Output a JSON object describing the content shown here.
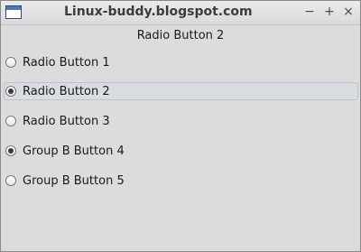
{
  "window": {
    "title": "Linux-buddy.blogspot.com",
    "icon": "app-window-icon",
    "controls": {
      "minimize": "−",
      "maximize": "+",
      "close": "×"
    }
  },
  "status": {
    "selected_text": "Radio Button 2"
  },
  "radios": [
    {
      "label": "Radio Button 1",
      "checked": false,
      "focused": false
    },
    {
      "label": "Radio Button 2",
      "checked": true,
      "focused": true
    },
    {
      "label": "Radio Button 3",
      "checked": false,
      "focused": false
    },
    {
      "label": "Group B Button 4",
      "checked": true,
      "focused": false
    },
    {
      "label": "Group B Button 5",
      "checked": false,
      "focused": false
    }
  ]
}
